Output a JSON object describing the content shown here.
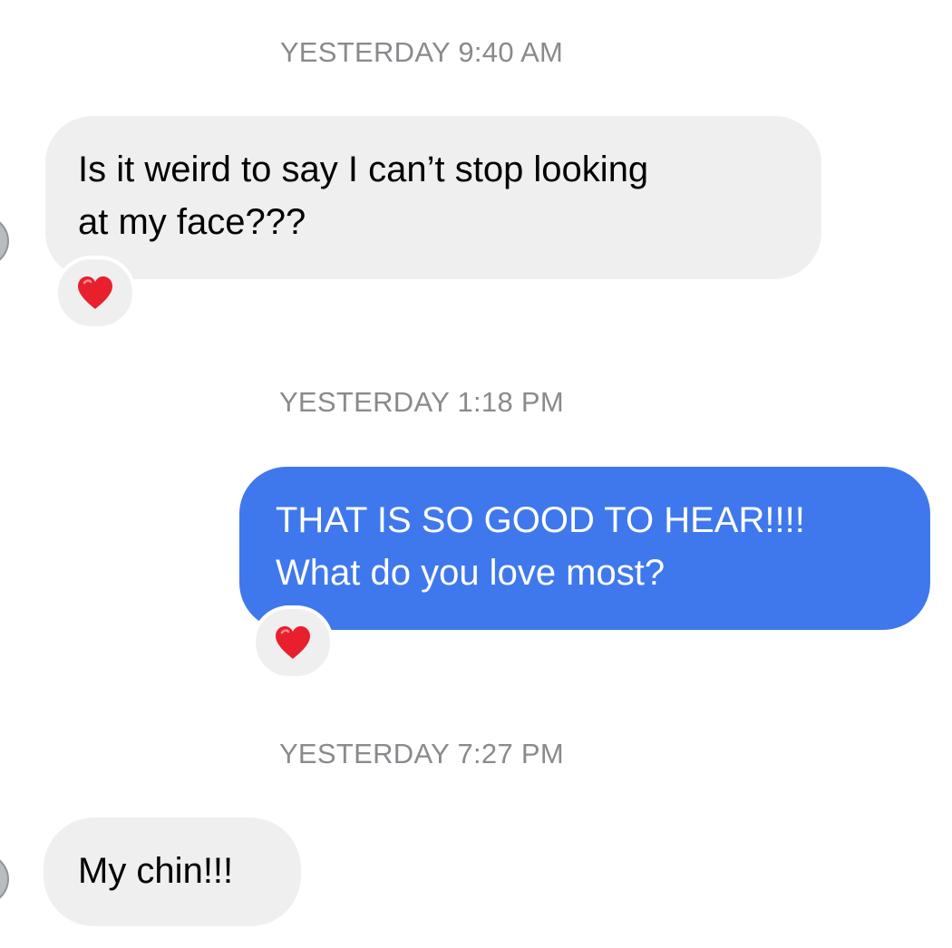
{
  "messages": [
    {
      "timestamp": "YESTERDAY 9:40 AM",
      "direction": "incoming",
      "lines": [
        "Is it weird to say I can’t stop looking",
        "at my face???"
      ],
      "reaction": "heart-icon"
    },
    {
      "timestamp": "YESTERDAY 1:18 PM",
      "direction": "outgoing",
      "lines": [
        "THAT IS SO GOOD TO HEAR!!!!",
        "What do you love most?"
      ],
      "reaction": "heart-icon"
    },
    {
      "timestamp": "YESTERDAY 7:27 PM",
      "direction": "incoming",
      "lines": [
        "My chin!!!"
      ]
    }
  ],
  "colors": {
    "incoming_bubble": "#efefef",
    "outgoing_bubble": "#3f78ec",
    "timestamp_text": "#8a8a8e",
    "reaction_heart": "#e8202e"
  }
}
